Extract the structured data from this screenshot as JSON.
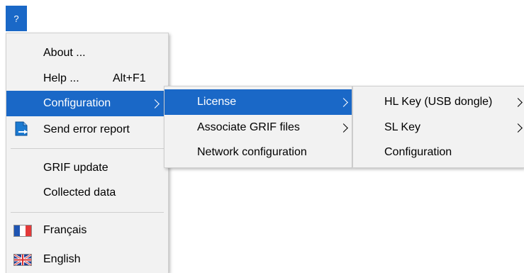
{
  "menubar": {
    "help_label": "?"
  },
  "menu_main": {
    "about": "About ...",
    "help": "Help ...",
    "help_shortcut": "Alt+F1",
    "configuration": "Configuration",
    "send_error": "Send error report",
    "grif_update": "GRIF update",
    "collected_data": "Collected data",
    "francais": "Français",
    "english": "English"
  },
  "menu_configuration": {
    "license": "License",
    "associate": "Associate GRIF files",
    "network": "Network configuration"
  },
  "menu_license": {
    "hl_key": "HL Key (USB dongle)",
    "sl_key": "SL Key",
    "configuration": "Configuration"
  },
  "colors": {
    "selection": "#1a68c7",
    "menu_bg": "#f2f2f2"
  },
  "icons": [
    "send-report-icon",
    "french-flag-icon",
    "uk-flag-icon",
    "submenu-arrow-icon"
  ]
}
